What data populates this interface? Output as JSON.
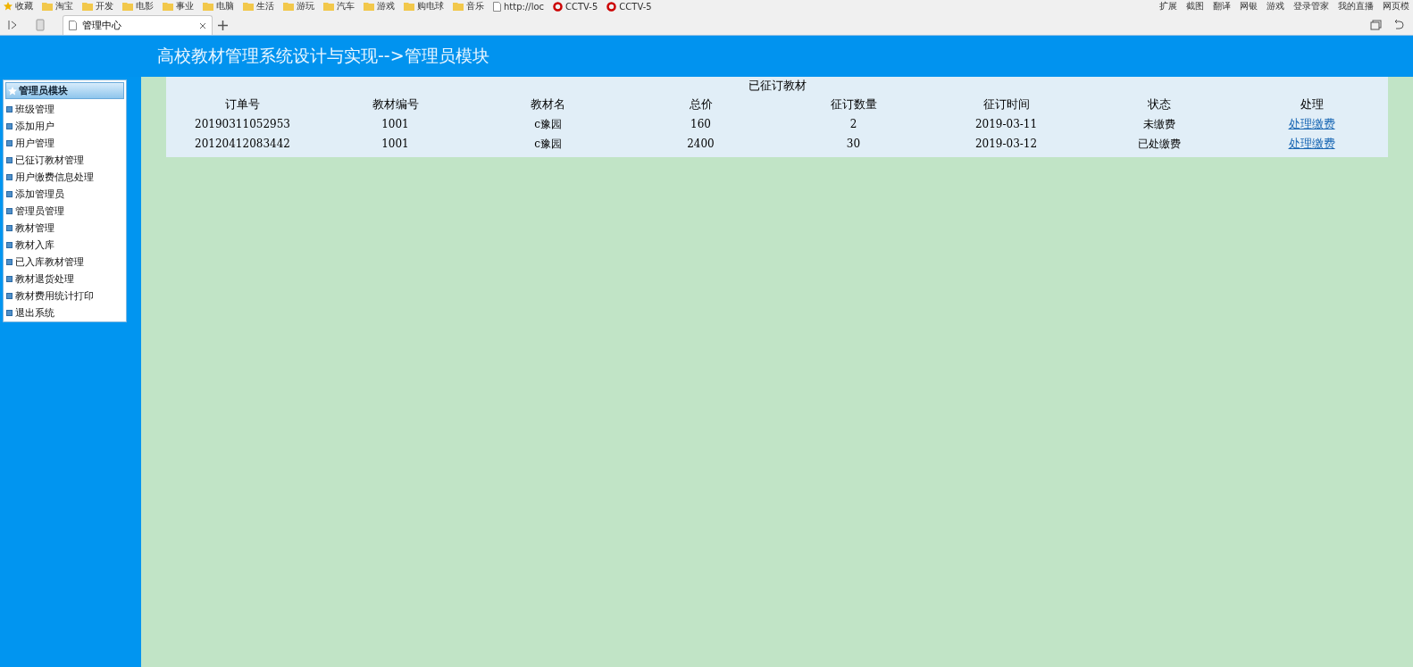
{
  "bookmarks": {
    "left": [
      {
        "label": "收藏",
        "kind": "star"
      },
      {
        "label": "淘宝",
        "kind": "folder"
      },
      {
        "label": "开发",
        "kind": "folder"
      },
      {
        "label": "电影",
        "kind": "folder"
      },
      {
        "label": "事业",
        "kind": "folder"
      },
      {
        "label": "电脑",
        "kind": "folder"
      },
      {
        "label": "生活",
        "kind": "folder"
      },
      {
        "label": "游玩",
        "kind": "folder"
      },
      {
        "label": "汽车",
        "kind": "folder"
      },
      {
        "label": "游戏",
        "kind": "folder"
      },
      {
        "label": "购电球",
        "kind": "folder"
      },
      {
        "label": "音乐",
        "kind": "folder"
      },
      {
        "label": "http://loc",
        "kind": "page"
      },
      {
        "label": "CCTV-5",
        "kind": "tv"
      },
      {
        "label": "CCTV-5",
        "kind": "tv"
      }
    ],
    "right": [
      "扩展",
      "截图",
      "翻译",
      "网银",
      "游戏",
      "登录管家",
      "我的直播",
      "网页模"
    ]
  },
  "tabs": [
    {
      "label": "管理中心",
      "selected": true
    }
  ],
  "header": {
    "title": "高校教材管理系统设计与实现-->管理员模块"
  },
  "sidebar": {
    "title": "管理员模块",
    "items": [
      "班级管理",
      "添加用户",
      "用户管理",
      "已征订教材管理",
      "用户缴费信息处理",
      "添加管理员",
      "管理员管理",
      "教材管理",
      "教材入库",
      "已入库教材管理",
      "教材退货处理",
      "教材费用统计打印",
      "退出系统"
    ]
  },
  "table": {
    "caption": "已征订教材",
    "columns": [
      "订单号",
      "教材编号",
      "教材名",
      "总价",
      "征订数量",
      "征订时间",
      "状态",
      "处理"
    ],
    "rows": [
      {
        "cells": [
          "20190311052953",
          "1001",
          "c豫园",
          "160",
          "2",
          "2019-03-11",
          "未缴费"
        ],
        "action": "处理缴费"
      },
      {
        "cells": [
          "20120412083442",
          "1001",
          "c豫园",
          "2400",
          "30",
          "2019-03-12",
          "已处缴费"
        ],
        "action": "处理缴费"
      }
    ]
  }
}
